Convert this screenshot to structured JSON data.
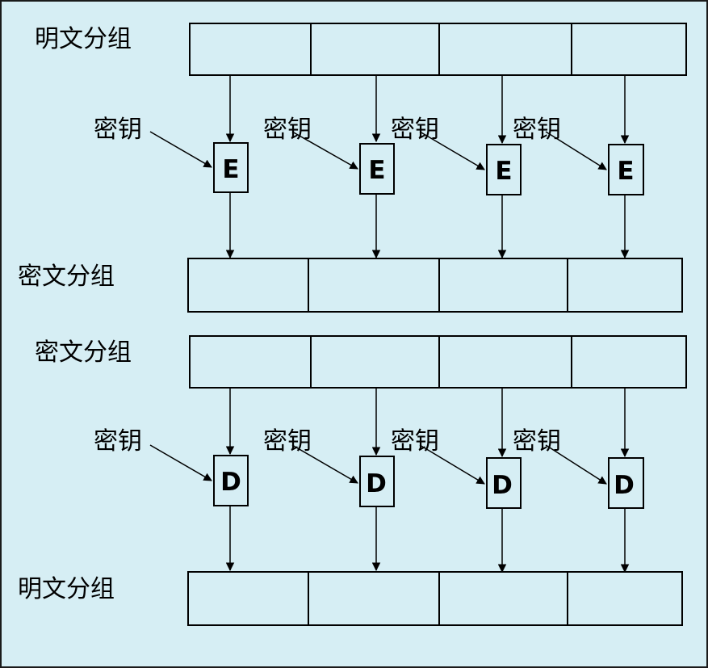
{
  "colors": {
    "background": "#d6eef4",
    "frame": "#1a1a1a",
    "stroke": "#000000",
    "box_fill": "#d6eef4"
  },
  "encrypt": {
    "input_label": "明文分组",
    "key_label": "密钥",
    "op_label": "E",
    "output_label": "密文分组"
  },
  "decrypt": {
    "input_label": "密文分组",
    "key_label": "密钥",
    "op_label": "D",
    "output_label": "明文分组"
  }
}
